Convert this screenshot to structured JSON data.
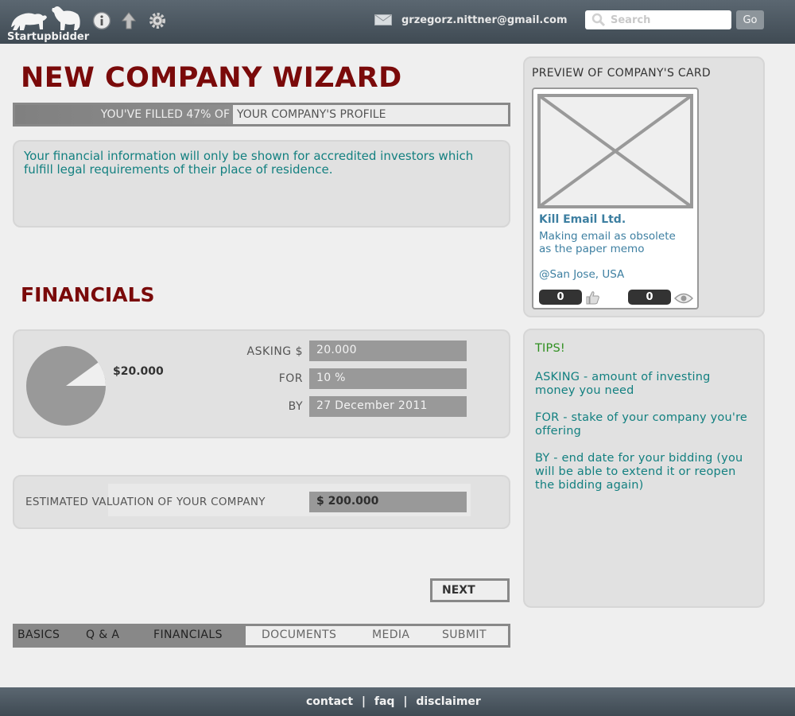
{
  "header": {
    "logo_text": "Startupbidder",
    "user_email": "grzegorz.nittner@gmail.com",
    "search_placeholder": "Search",
    "go_label": "Go",
    "icons": [
      "info-icon",
      "upload-arrow-icon",
      "gear-icon",
      "mail-icon",
      "search-icon"
    ]
  },
  "wizard": {
    "title": "NEW COMPANY WIZARD",
    "progress_filled_text": "YOU'VE FILLED 47% OF",
    "progress_rest_text": "YOUR COMPANY'S PROFILE",
    "progress_percent": 47,
    "notice": "Your financial information will only be shown for accredited investors which fulfill legal requirements of their place of residence."
  },
  "financials": {
    "title": "FINANCIALS",
    "pie_label": "$20.000",
    "pie_fraction": 0.1,
    "asking_label": "ASKING $",
    "asking_value": "20.000",
    "for_label": "FOR",
    "for_value": "10 %",
    "by_label": "BY",
    "by_value": "27 December 2011",
    "valuation_label": "ESTIMATED VALUATION OF YOUR COMPANY",
    "valuation_value": "$ 200.000"
  },
  "next_label": "NEXT",
  "steps": [
    {
      "label": "BASICS",
      "done": true
    },
    {
      "label": "Q & A",
      "done": true
    },
    {
      "label": "FINANCIALS",
      "done": true,
      "current": true
    },
    {
      "label": "DOCUMENTS",
      "done": false
    },
    {
      "label": "MEDIA",
      "done": false
    },
    {
      "label": "SUBMIT",
      "done": false
    }
  ],
  "preview": {
    "title": "PREVIEW OF COMPANY'S CARD",
    "company_name": "Kill Email Ltd.",
    "description": "Making email as obsolete as the paper memo",
    "location": "@San Jose, USA",
    "likes": "0",
    "views": "0"
  },
  "tips": {
    "title": "TIPS!",
    "items": [
      "ASKING - amount of investing money you need",
      "FOR - stake of your company you're offering",
      "BY - end date for your bidding (you will be able to extend it or reopen the bidding again)"
    ]
  },
  "footer": {
    "contact": "contact",
    "faq": "faq",
    "disclaimer": "disclaimer",
    "separator": "|"
  },
  "colors": {
    "title_red": "#7a0a0a",
    "teal_text": "#138080",
    "tips_green": "#2e8f1f",
    "link_blue": "#3d7fa1",
    "header_dark": "#3f4a53"
  }
}
